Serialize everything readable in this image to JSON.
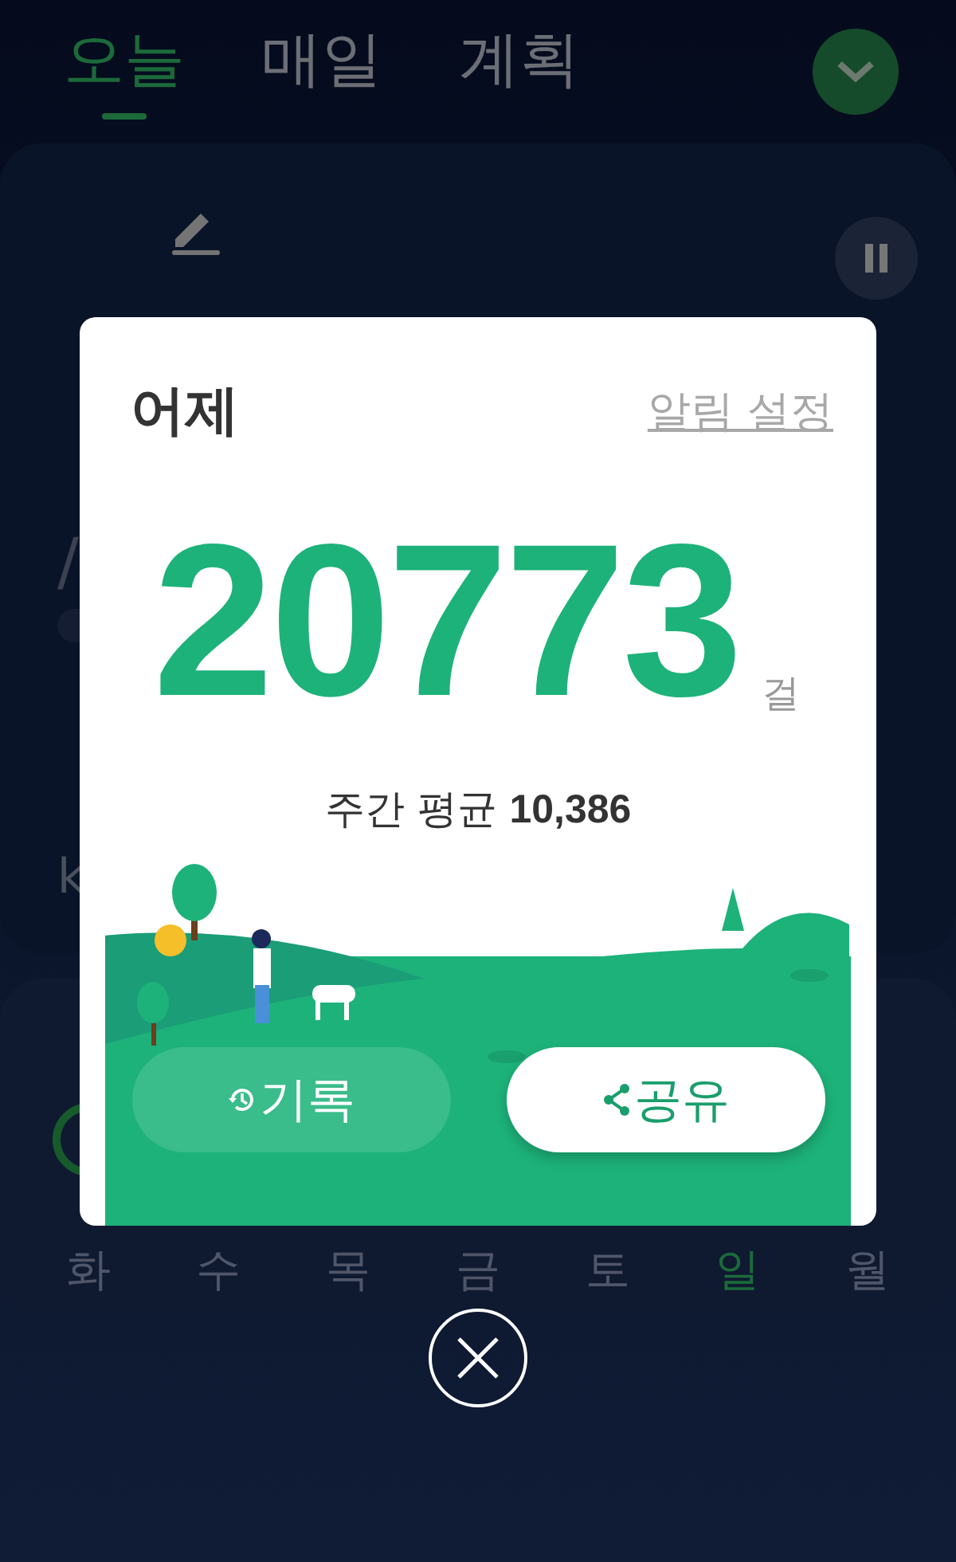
{
  "tabs": [
    {
      "label": "오늘",
      "selected": true
    },
    {
      "label": "매일",
      "selected": false
    },
    {
      "label": "계획",
      "selected": false
    }
  ],
  "today_card": {
    "separator": "/",
    "distance_unit": "k"
  },
  "week_card": {
    "days": [
      {
        "label": "화",
        "selected": false
      },
      {
        "label": "수",
        "selected": false
      },
      {
        "label": "목",
        "selected": false
      },
      {
        "label": "금",
        "selected": false
      },
      {
        "label": "토",
        "selected": false
      },
      {
        "label": "일",
        "selected": true
      },
      {
        "label": "월",
        "selected": false
      }
    ]
  },
  "dialog": {
    "title": "어제",
    "link": "알림 설정",
    "steps": "20773",
    "unit": "걸",
    "weekly_average": "주간 평균 **10,386**",
    "buttons": [
      {
        "label": "기록",
        "kind": "history"
      },
      {
        "label": "공유",
        "kind": "share"
      }
    ]
  }
}
